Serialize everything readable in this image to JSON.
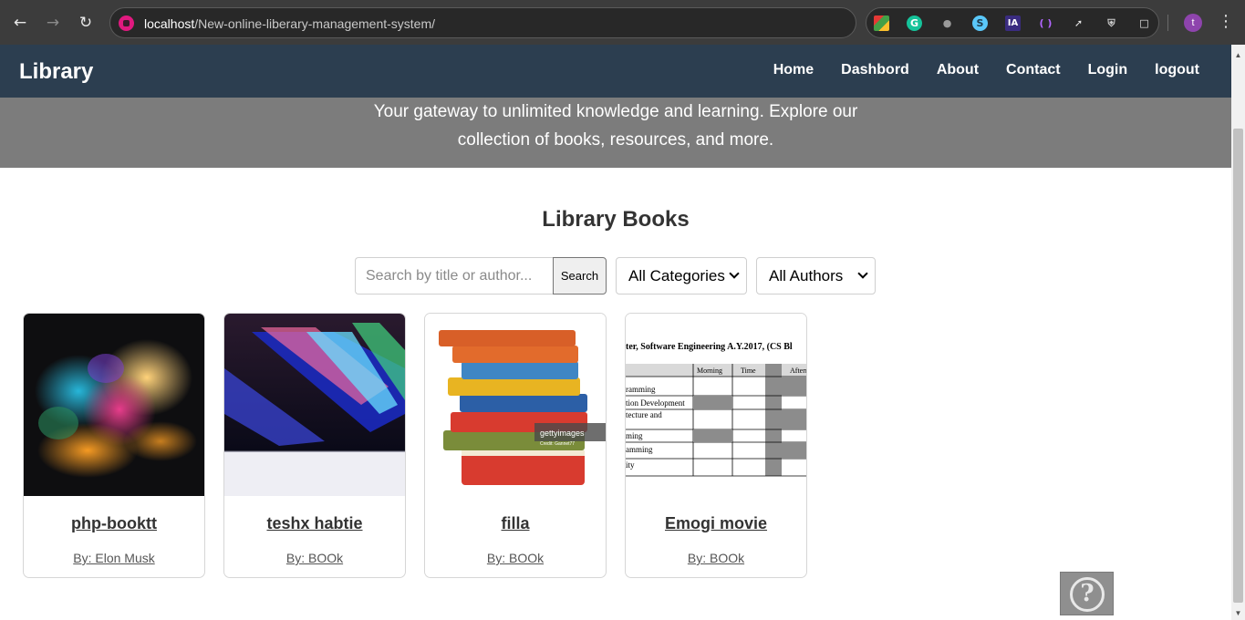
{
  "browser": {
    "url_host": "localhost",
    "url_path": "/New-online-liberary-management-system/",
    "profile_initial": "t",
    "extensions": [
      "grammarly-icon",
      "s-icon",
      "ia-icon",
      "brackets-icon",
      "eyedropper-icon",
      "shield-icon",
      "puzzle-icon"
    ]
  },
  "site": {
    "brand": "Library",
    "nav": [
      "Home",
      "Dashbord",
      "About",
      "Contact",
      "Login",
      "logout"
    ],
    "hero_text": "Your gateway to unlimited knowledge and learning. Explore our collection of books, resources, and more.",
    "section_title": "Library Books"
  },
  "filters": {
    "search_placeholder": "Search by title or author...",
    "search_button": "Search",
    "category_selected": "All Categories",
    "author_selected": "All Authors"
  },
  "books": [
    {
      "title": "php-booktt",
      "author": "By: Elon Musk"
    },
    {
      "title": "teshx habtie",
      "author": "By: BOOk"
    },
    {
      "title": "filla",
      "author": "By: BOOk"
    },
    {
      "title": "Emogi movie",
      "author": "By: BOOk"
    }
  ],
  "cover4_text": {
    "heading": "ter, Software Engineering A.Y.2017, (CS Bl",
    "col_morning": "Morning",
    "col_time": "Time",
    "col_after": "Aftern",
    "rows": [
      "ramming",
      "tion Development",
      "tecture and",
      "ming",
      "amming",
      "ity"
    ]
  },
  "cover3_watermark": "gettyimages",
  "cover3_credit": "Credit: Gannet77",
  "colors": {
    "navbar": "#2c3e50",
    "hero": "#7c7c7c"
  }
}
